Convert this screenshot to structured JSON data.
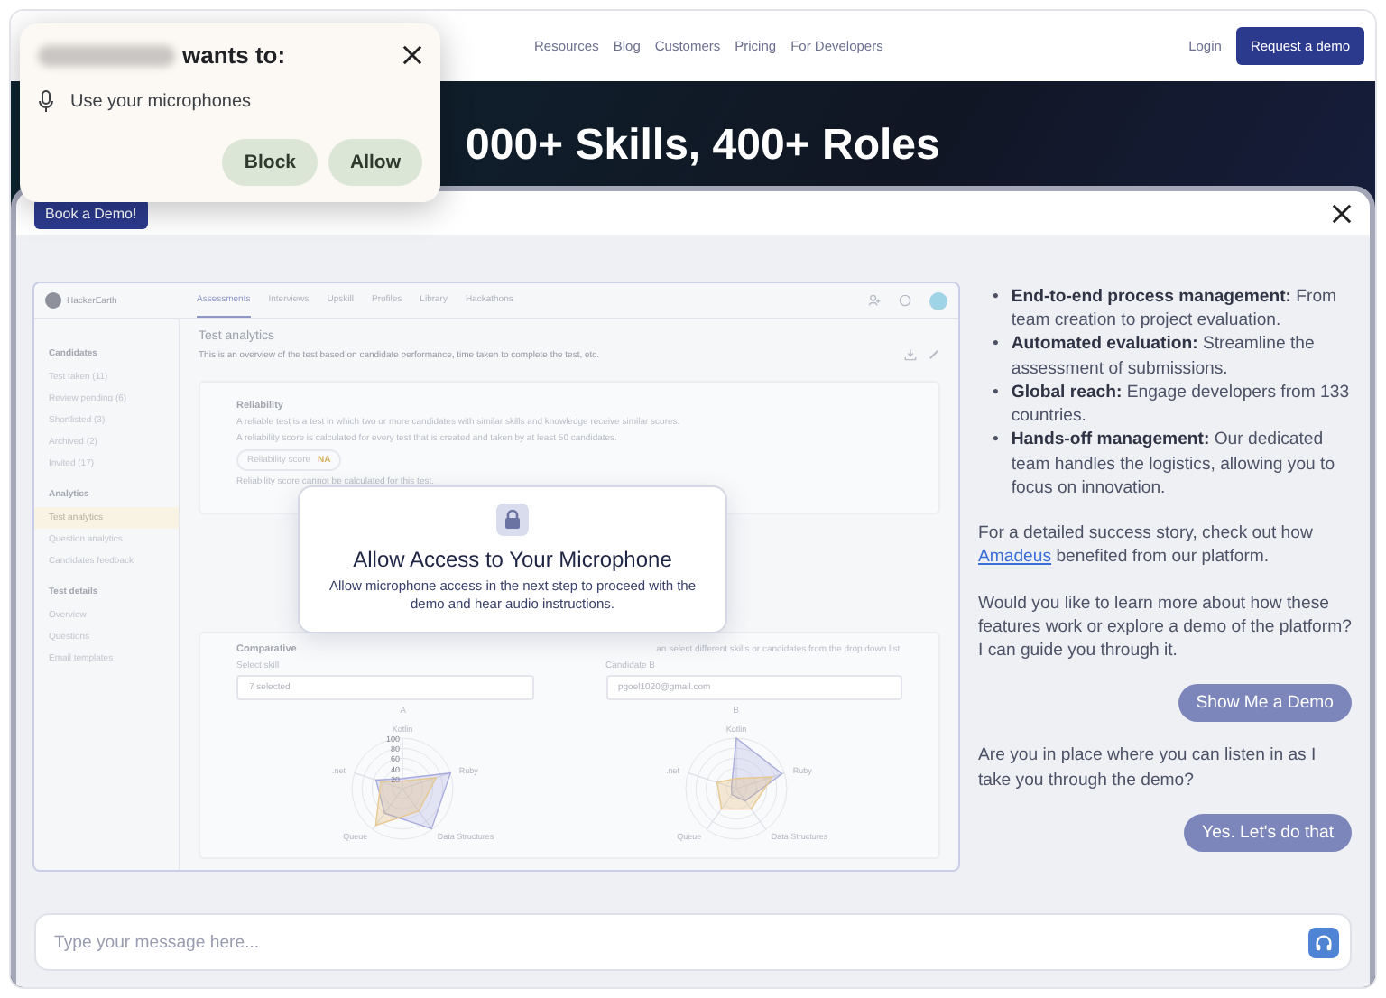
{
  "nav": {
    "links": [
      "Resources",
      "Blog",
      "Customers",
      "Pricing",
      "For Developers"
    ],
    "login": "Login",
    "cta": "Request a demo"
  },
  "hero": {
    "headline": "000+ Skills, 400+ Roles"
  },
  "permission_popup": {
    "title": "wants to:",
    "request": "Use your microphones",
    "buttons": [
      "Block",
      "Allow"
    ]
  },
  "modal": {
    "book_button": "Book a Demo!",
    "app": {
      "brand": "HackerEarth",
      "tabs": [
        {
          "label": "Assessments",
          "selected": true
        },
        {
          "label": "Interviews",
          "selected": false
        },
        {
          "label": "Upskill",
          "selected": false
        },
        {
          "label": "Profiles",
          "selected": false
        },
        {
          "label": "Library",
          "selected": false
        },
        {
          "label": "Hackathons",
          "selected": false
        }
      ],
      "sidebar": [
        {
          "heading": "Candidates",
          "items": [
            {
              "label": "Test taken (11)",
              "selected": false
            },
            {
              "label": "Review pending (6)",
              "selected": false
            },
            {
              "label": "Shortlisted (3)",
              "selected": false
            },
            {
              "label": "Archived (2)",
              "selected": false
            },
            {
              "label": "Invited (17)",
              "selected": false
            }
          ]
        },
        {
          "heading": "Analytics",
          "items": [
            {
              "label": "Test analytics",
              "selected": true
            },
            {
              "label": "Question analytics",
              "selected": false
            },
            {
              "label": "Candidates feedback",
              "selected": false
            }
          ]
        },
        {
          "heading": "Test details",
          "items": [
            {
              "label": "Overview",
              "selected": false
            },
            {
              "label": "Questions",
              "selected": false
            },
            {
              "label": "Email templates",
              "selected": false
            }
          ]
        }
      ],
      "page_title": "Test analytics",
      "page_description": "This is an overview of the test based on candidate performance, time taken to complete the test, etc.",
      "reliability": {
        "title": "Reliability",
        "lines": [
          "A reliable test is a test in which two or more candidates with similar skills and knowledge receive similar scores.",
          "A reliability score is calculated for every test that is created and taken by at least 50 candidates."
        ],
        "score_label": "Reliability score",
        "score_value": "NA",
        "note": "Reliability score cannot be calculated for this test."
      },
      "comparative": {
        "title": "Comparative",
        "description": "an select different skills or candidates from the drop down list.",
        "skill_label": "Select skill",
        "skill_value": "7 selected",
        "candidate_label": "Candidate B",
        "candidate_value": "pgoel1020@gmail.com",
        "charts": [
          {
            "label": "A",
            "axes": [
              "Kotlin",
              "Ruby",
              "Data Structures",
              "Queue",
              ".net"
            ],
            "ticks": [
              "100",
              "80",
              "60",
              "40",
              "20"
            ]
          },
          {
            "label": "B",
            "axes": [
              "Kotlin",
              "Ruby",
              "Data Structures",
              "Queue",
              ".net"
            ]
          }
        ]
      }
    },
    "mic_dialog": {
      "title": "Allow Access to Your Microphone",
      "message": "Allow microphone access in the next step to proceed with the demo and hear audio instructions."
    },
    "chat": {
      "bullets": [
        {
          "marker": "•",
          "text": "**End-to-end process management:** From team creation to project evaluation."
        },
        {
          "marker": "•",
          "text": "**Automated evaluation:** Streamline the assessment of submissions."
        },
        {
          "marker": "•",
          "text": "**Global reach:** Engage developers from 133 countries."
        },
        {
          "marker": "•",
          "text": "**Hands-off management:** Our dedicated team handles the logistics, allowing you to focus on innovation."
        }
      ],
      "messages": [
        {
          "kind": "text",
          "before": "For a detailed success story, check out how ",
          "link": "Amadeus",
          "after": " benefited from our platform."
        },
        {
          "kind": "text",
          "before": "Would you like to learn more about how these features work or explore a demo of the platform? I can guide you through it."
        },
        {
          "kind": "reply",
          "before": "Show Me a Demo"
        },
        {
          "kind": "text",
          "before": "Are you in place where you can listen in as I take you through the demo?"
        },
        {
          "kind": "reply",
          "before": "Yes. Let's do that"
        }
      ],
      "input_placeholder": "Type your message here..."
    }
  }
}
